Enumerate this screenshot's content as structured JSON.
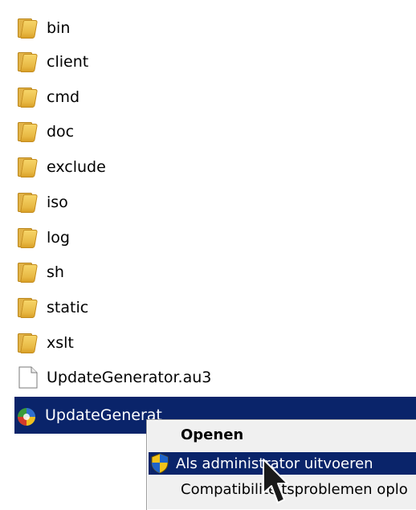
{
  "files": [
    {
      "name": "bin",
      "type": "folder",
      "icon": "folder-icon"
    },
    {
      "name": "client",
      "type": "folder",
      "icon": "folder-icon"
    },
    {
      "name": "cmd",
      "type": "folder",
      "icon": "folder-icon"
    },
    {
      "name": "doc",
      "type": "folder",
      "icon": "folder-icon"
    },
    {
      "name": "exclude",
      "type": "folder",
      "icon": "folder-icon"
    },
    {
      "name": "iso",
      "type": "folder",
      "icon": "folder-icon"
    },
    {
      "name": "log",
      "type": "folder",
      "icon": "folder-icon"
    },
    {
      "name": "sh",
      "type": "folder",
      "icon": "folder-icon"
    },
    {
      "name": "static",
      "type": "folder",
      "icon": "folder-icon"
    },
    {
      "name": "xslt",
      "type": "folder",
      "icon": "folder-icon"
    },
    {
      "name": "UpdateGenerator.au3",
      "type": "file",
      "icon": "document-icon"
    },
    {
      "name": "UpdateGenerat",
      "type": "application",
      "icon": "app-icon",
      "selected": true
    }
  ],
  "context_menu": {
    "items": [
      {
        "label": "Openen",
        "default": true
      },
      {
        "label": "Als administrator uitvoeren",
        "icon": "uac-shield-icon",
        "highlighted": true
      },
      {
        "label": "Compatibiliteitsproblemen oplo"
      }
    ]
  },
  "colors": {
    "selection": "#0a246a",
    "folder": "#e8b843",
    "menu_background": "#f0f0f0"
  }
}
